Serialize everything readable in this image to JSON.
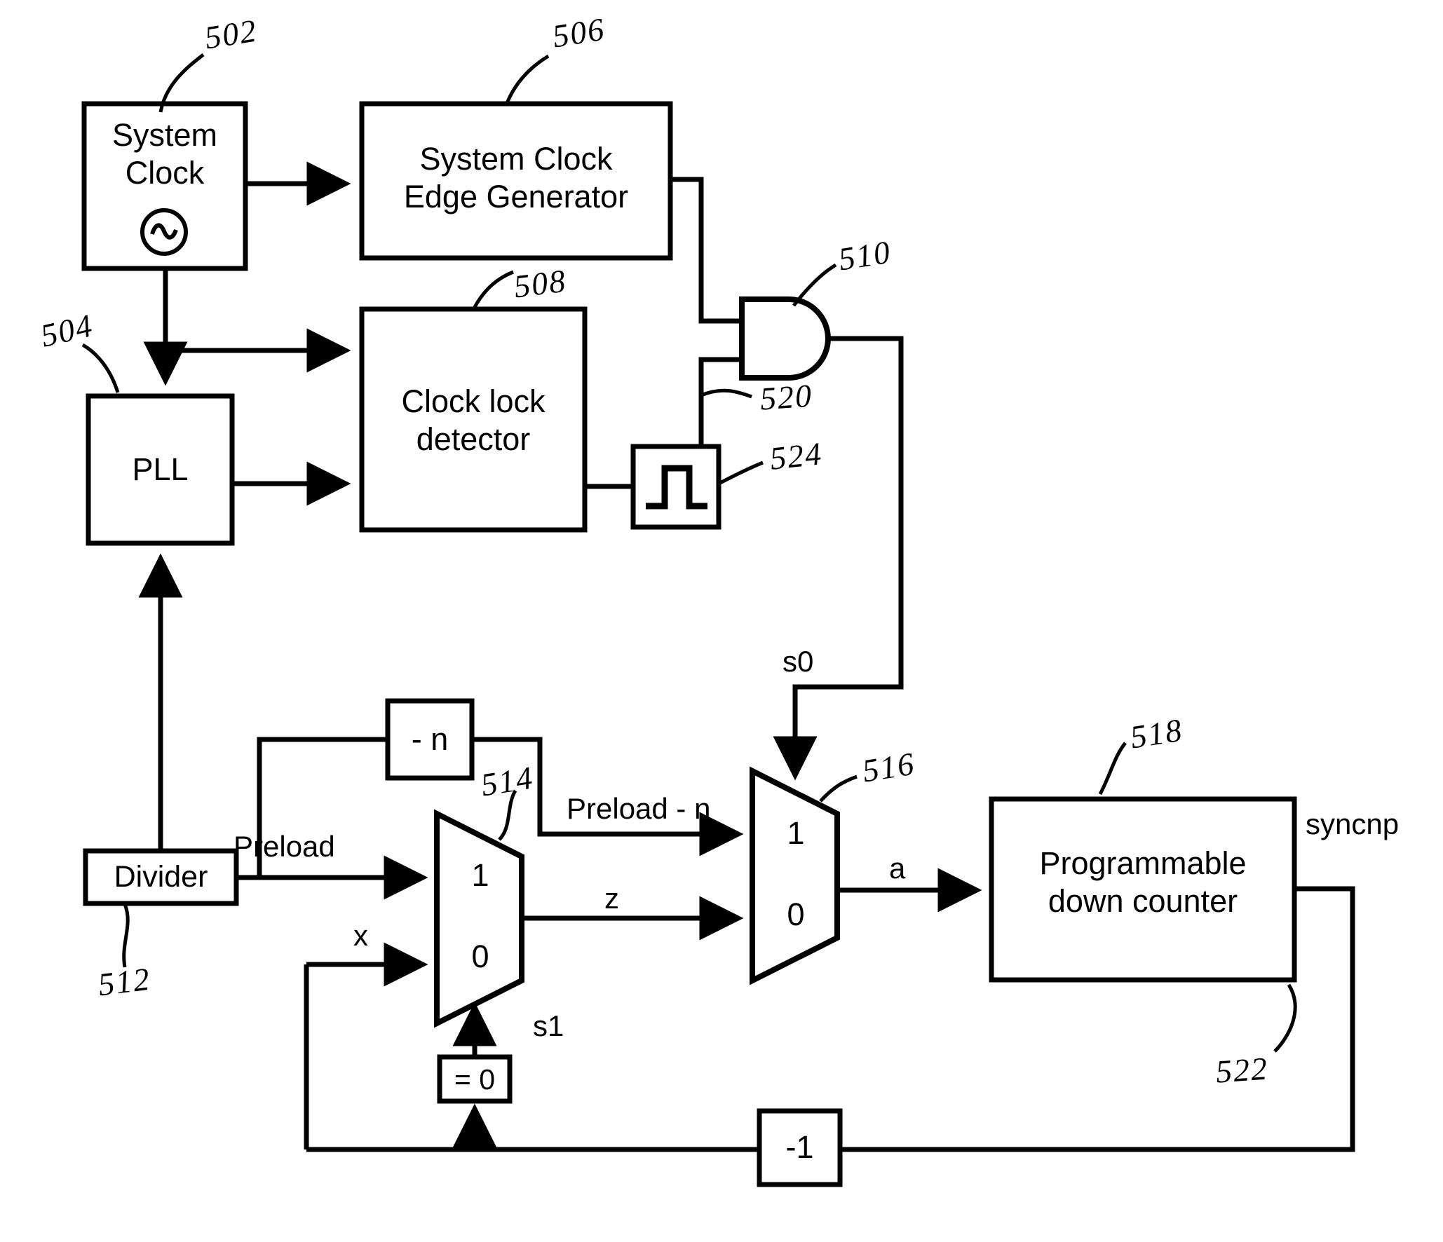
{
  "diagram": {
    "title": "Clock synchronization block diagram",
    "blocks": {
      "system_clock": "System Clock",
      "edge_generator": "System Clock\nEdge Generator",
      "pll": "PLL",
      "clock_lock_detector": "Clock lock\ndetector",
      "divider": "Divider",
      "minus_n": "- n",
      "eq_zero": "= 0",
      "minus_one": "-1",
      "down_counter": "Programmable\ndown counter"
    },
    "block_lines": {
      "system_clock_l1": "System",
      "system_clock_l2": "Clock",
      "edge_generator_l1": "System Clock",
      "edge_generator_l2": "Edge Generator",
      "clock_lock_l1": "Clock lock",
      "clock_lock_l2": "detector",
      "counter_l1": "Programmable",
      "counter_l2": "down counter",
      "pll": "PLL",
      "divider": "Divider",
      "minus_n": "- n",
      "eq_zero": "= 0",
      "minus_one": "-1"
    },
    "mux_ports": {
      "mux514_one": "1",
      "mux514_zero": "0",
      "mux516_one": "1",
      "mux516_zero": "0"
    },
    "signals": {
      "s0": "s0",
      "s1": "s1",
      "x": "x",
      "z": "z",
      "a": "a",
      "preload": "Preload",
      "preload_minus_n": "Preload - n",
      "syncnp": "syncnp"
    },
    "reference_numerals": {
      "n502": "502",
      "n504": "504",
      "n506": "506",
      "n508": "508",
      "n510": "510",
      "n512": "512",
      "n514": "514",
      "n516": "516",
      "n518": "518",
      "n520": "520",
      "n522": "522",
      "n524": "524"
    },
    "icons": {
      "oscillator": "sine-wave-icon",
      "pulse": "pulse-waveform-icon",
      "and_gate": "and-gate-icon"
    },
    "colors": {
      "stroke": "#000000",
      "background": "#ffffff"
    }
  }
}
